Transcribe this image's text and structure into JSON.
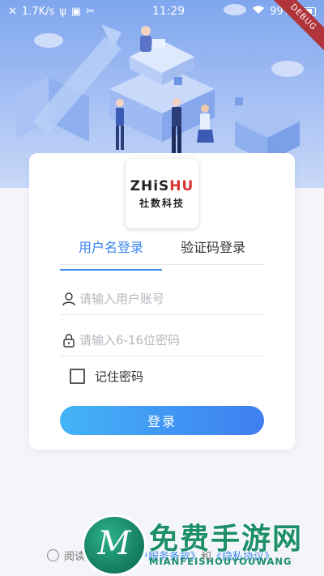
{
  "status_bar": {
    "net_speed": "1.7K/s",
    "time": "11:29",
    "battery": "99%",
    "debug_banner": "DEBUG"
  },
  "logo": {
    "brand_prefix": "ZHiS",
    "brand_suffix": "HU",
    "brand_cn": "社数科技"
  },
  "tabs": [
    {
      "label": "用户名登录",
      "active": true
    },
    {
      "label": "验证码登录",
      "active": false
    }
  ],
  "form": {
    "username_placeholder": "请输入用户账号",
    "password_placeholder": "请输入6-16位密码",
    "remember_label": "记住密码",
    "remember_checked": false,
    "login_button": "登录"
  },
  "agreement": {
    "prefix": "阅读并同意",
    "service_link": "《用户服务条款》",
    "and": "和",
    "privacy_link": "《隐私协议》",
    "checked": false
  },
  "watermark": {
    "badge_letter": "M",
    "title": "免费手游网",
    "subtitle": "MIANFEISHOUYOUWANG"
  },
  "colors": {
    "accent": "#3b86ef",
    "hero_top": "#7fa6ee",
    "button_start": "#43b4f7",
    "button_end": "#3f7ef0",
    "watermark_green": "#1d8f6a"
  }
}
